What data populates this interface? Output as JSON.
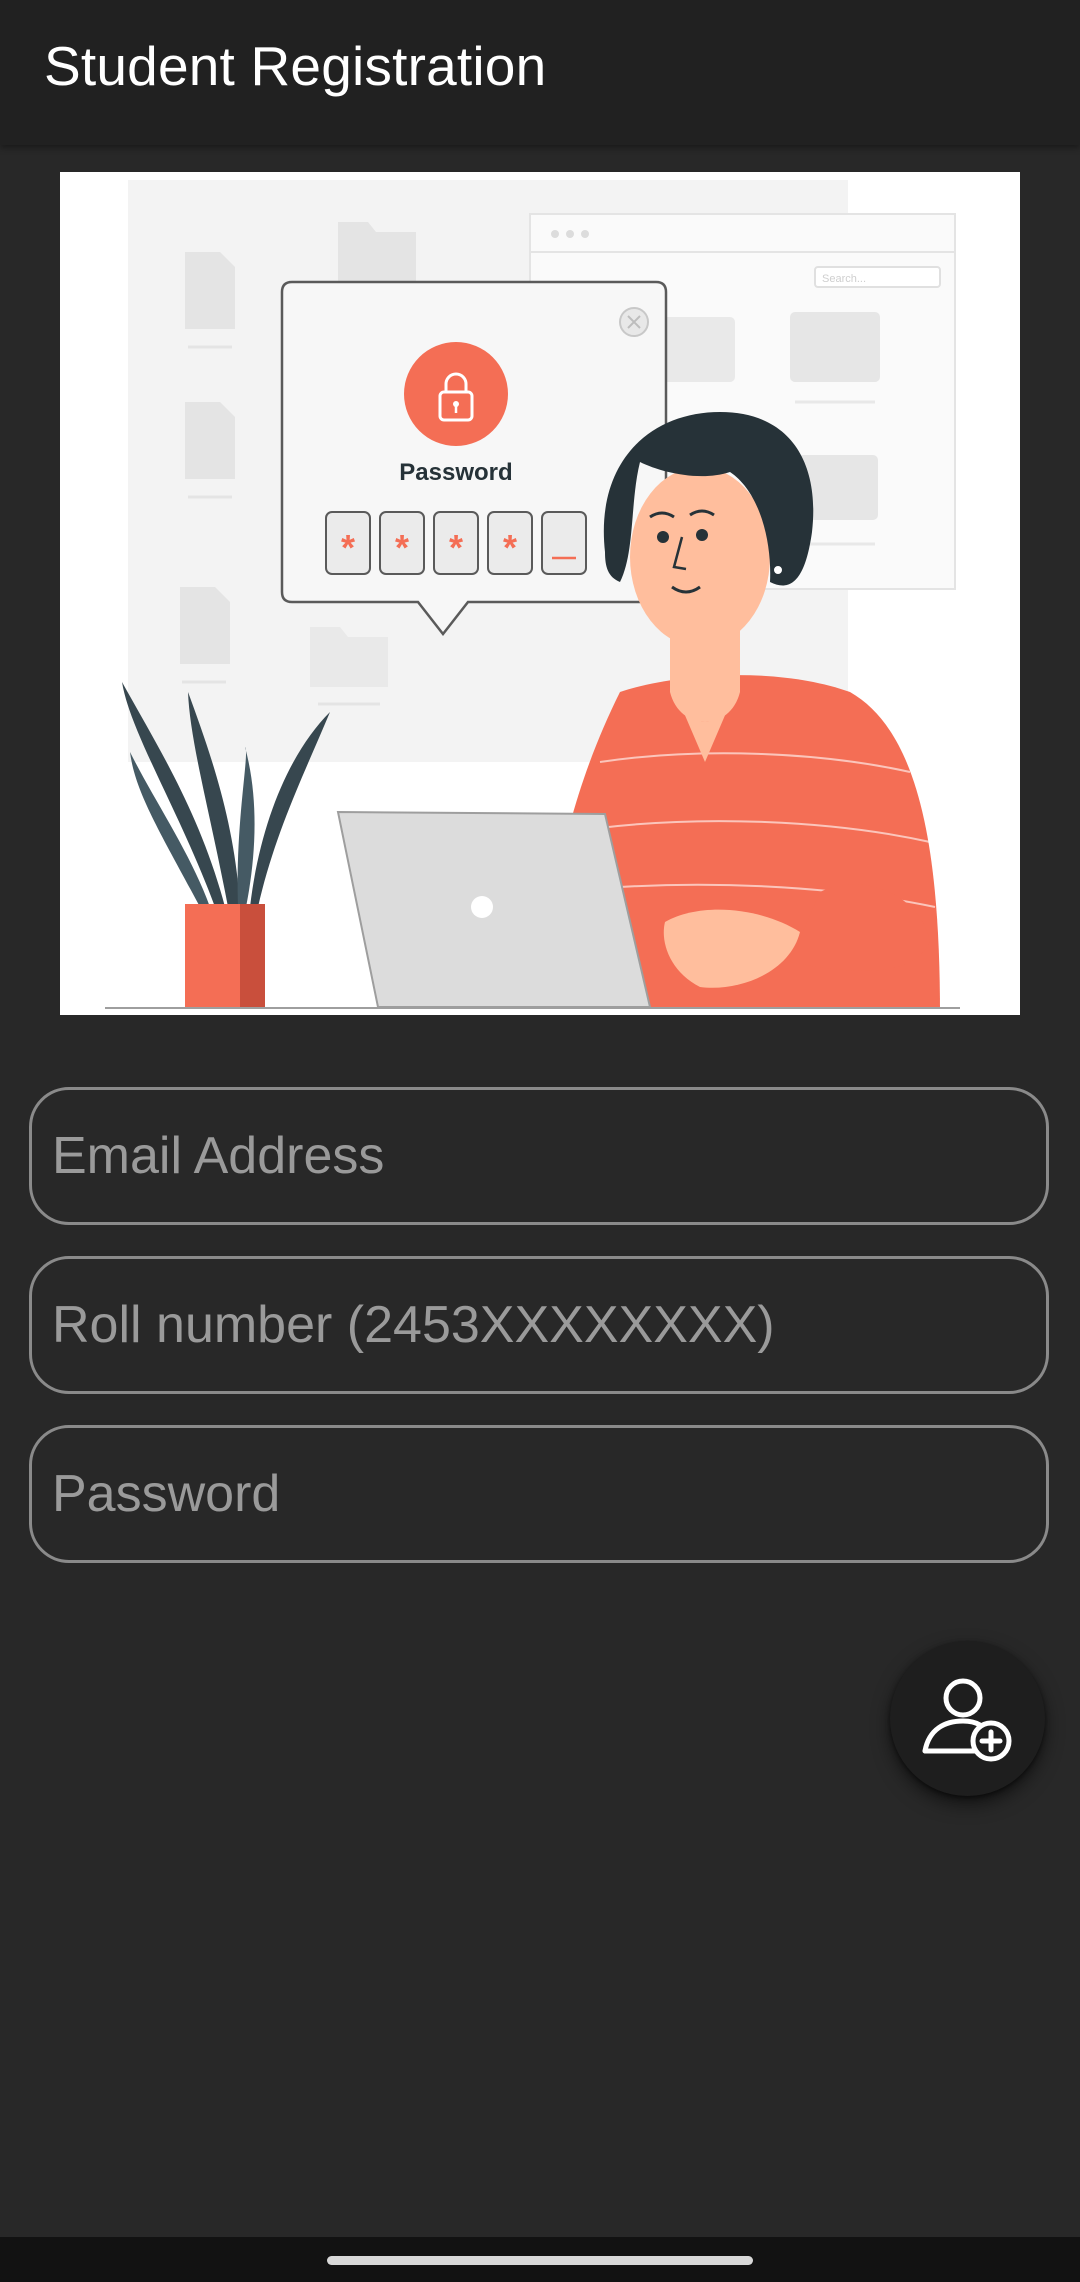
{
  "app_bar": {
    "title": "Student Registration"
  },
  "illustration": {
    "password_label": "Password",
    "pin_chars": [
      "*",
      "*",
      "*",
      "*",
      ""
    ],
    "search_placeholder": "Search..."
  },
  "form": {
    "email_placeholder": "Email Address",
    "email_value": "",
    "roll_placeholder": "Roll number (2453XXXXXXXX)",
    "roll_value": "",
    "password_placeholder": "Password",
    "password_value": ""
  },
  "fab": {
    "icon": "add-user-icon"
  },
  "colors": {
    "background": "#282828",
    "app_bar": "#212121",
    "accent": "#F46E55",
    "field_border": "#8A8A8A",
    "placeholder": "#9A9A9A"
  }
}
